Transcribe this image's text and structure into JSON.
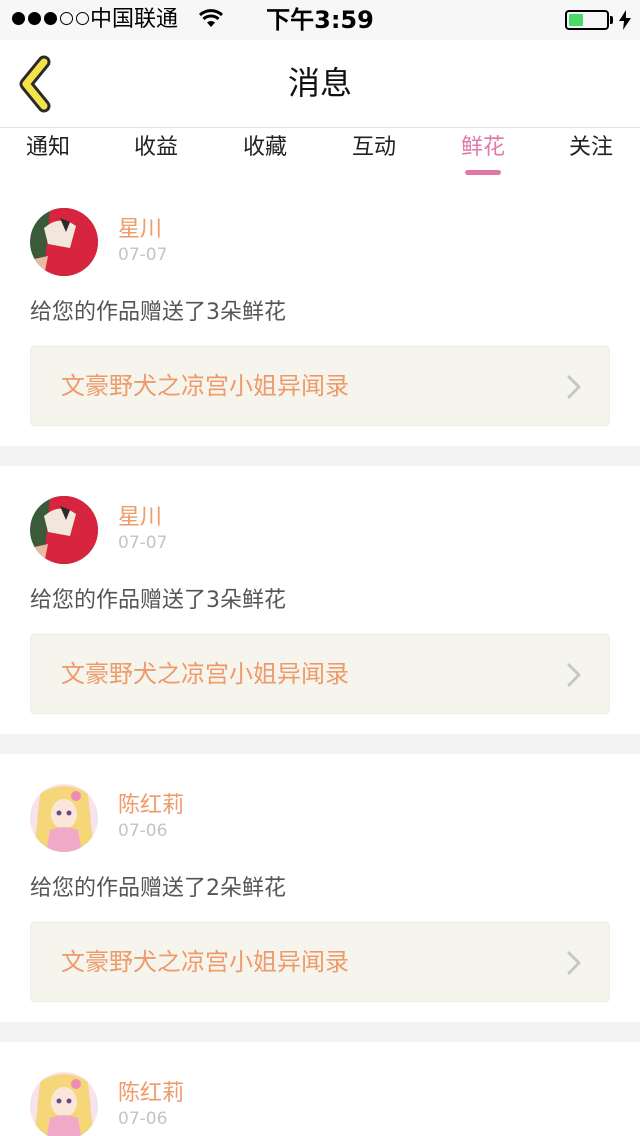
{
  "status_bar": {
    "carrier": "中国联通",
    "time": "下午3:59",
    "signal_filled": 3,
    "signal_total": 5,
    "battery_level": 0.4,
    "battery_color": "#4cd964"
  },
  "nav": {
    "title": "消息",
    "back_icon": "chevron-left-icon",
    "back_color": "#f3e24a"
  },
  "tabs": [
    {
      "label": "通知",
      "active": false
    },
    {
      "label": "收益",
      "active": false
    },
    {
      "label": "收藏",
      "active": false
    },
    {
      "label": "互动",
      "active": false
    },
    {
      "label": "鲜花",
      "active": true
    },
    {
      "label": "关注",
      "active": false
    }
  ],
  "accent_color": "#e277a8",
  "messages": [
    {
      "user": "星川",
      "date": "07-07",
      "text": "给您的作品赠送了3朵鲜花",
      "work": "文豪野犬之凉宫小姐异闻录",
      "avatar": "avatar-red-anime"
    },
    {
      "user": "星川",
      "date": "07-07",
      "text": "给您的作品赠送了3朵鲜花",
      "work": "文豪野犬之凉宫小姐异闻录",
      "avatar": "avatar-red-anime"
    },
    {
      "user": "陈红莉",
      "date": "07-06",
      "text": "给您的作品赠送了2朵鲜花",
      "work": "文豪野犬之凉宫小姐异闻录",
      "avatar": "avatar-blonde-anime"
    },
    {
      "user": "陈红莉",
      "date": "07-06",
      "text": "",
      "work": "",
      "avatar": "avatar-blonde-anime"
    }
  ]
}
